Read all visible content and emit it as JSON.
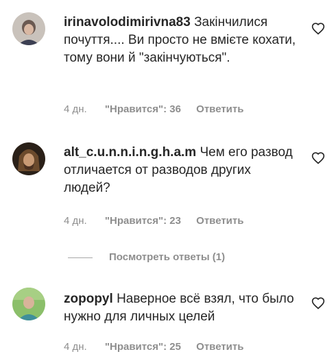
{
  "comments": [
    {
      "username": "irinavolodimirivna83",
      "text": "Закінчилися почуття.... Ви просто не вмієте кохати, тому вони й \"закінчуються\".",
      "time": "4 дн.",
      "likes": "\"Нравится\": 36",
      "reply": "Ответить",
      "avatar_icon": "user-avatar"
    },
    {
      "username": "alt_c.u.n.n.i.n.g.h.a.m",
      "text": "Чем его развод отличается от разводов других людей?",
      "time": "4 дн.",
      "likes": "\"Нравится\": 23",
      "reply": "Ответить",
      "avatar_icon": "user-avatar"
    },
    {
      "username": "zopopyl",
      "text": "Наверное всё взял, что было нужно для личных целей",
      "time": "4 дн.",
      "likes": "\"Нравится\": 25",
      "reply": "Ответить",
      "avatar_icon": "user-avatar"
    }
  ],
  "view_replies": "Посмотреть ответы (1)",
  "heart_icon": "heart-outline-icon"
}
